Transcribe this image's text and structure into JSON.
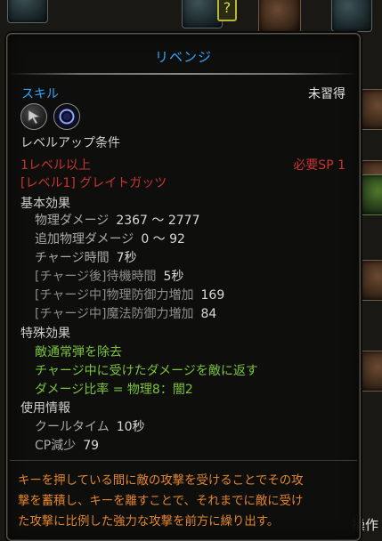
{
  "background": {
    "hint_symbol": "?",
    "corner_text": "操作"
  },
  "tooltip": {
    "title": "リベンジ",
    "skill_label": "スキル",
    "status": "未習得",
    "icons": [
      "cursor-arrow-icon",
      "dark-orb-icon"
    ],
    "levelup": {
      "heading": "レベルアップ条件",
      "level_req": "1レベル以上",
      "sp_req": "必要SP 1",
      "prereq_skill": "[レベル1] グレイトガッツ"
    },
    "basic_effects": {
      "heading": "基本効果",
      "rows": [
        {
          "label": "物理ダメージ",
          "value": "2367 ～ 2777"
        },
        {
          "label": "追加物理ダメージ",
          "value": "0 ～ 92"
        },
        {
          "label": "チャージ時間",
          "value": "7秒"
        },
        {
          "label": "[チャージ後]待機時間",
          "value": "5秒"
        },
        {
          "label": "[チャージ中]物理防御力増加",
          "value": "169"
        },
        {
          "label": "[チャージ中]魔法防御力増加",
          "value": "84"
        }
      ]
    },
    "special_effects": {
      "heading": "特殊効果",
      "lines": [
        "敵通常弾を除去",
        "チャージ中に受けたダメージを敵に返す",
        "ダメージ比率 = 物理8：闇2"
      ]
    },
    "usage": {
      "heading": "使用情報",
      "rows": [
        {
          "label": "クールタイム",
          "value": "10秒"
        },
        {
          "label": "CP減少",
          "value": "79"
        }
      ]
    },
    "description_lines": [
      "キーを押している間に敵の攻撃を受けることでその攻",
      "撃を蓄積し、キーを離すことで、それまでに敵に受け",
      "た攻撃に比例した強力な攻撃を前方に繰り出す。"
    ]
  },
  "colors": {
    "title_blue": "#2fa6ff",
    "requirement_red": "#c8342e",
    "special_green": "#7cc43a",
    "description_orange": "#e3852b"
  }
}
